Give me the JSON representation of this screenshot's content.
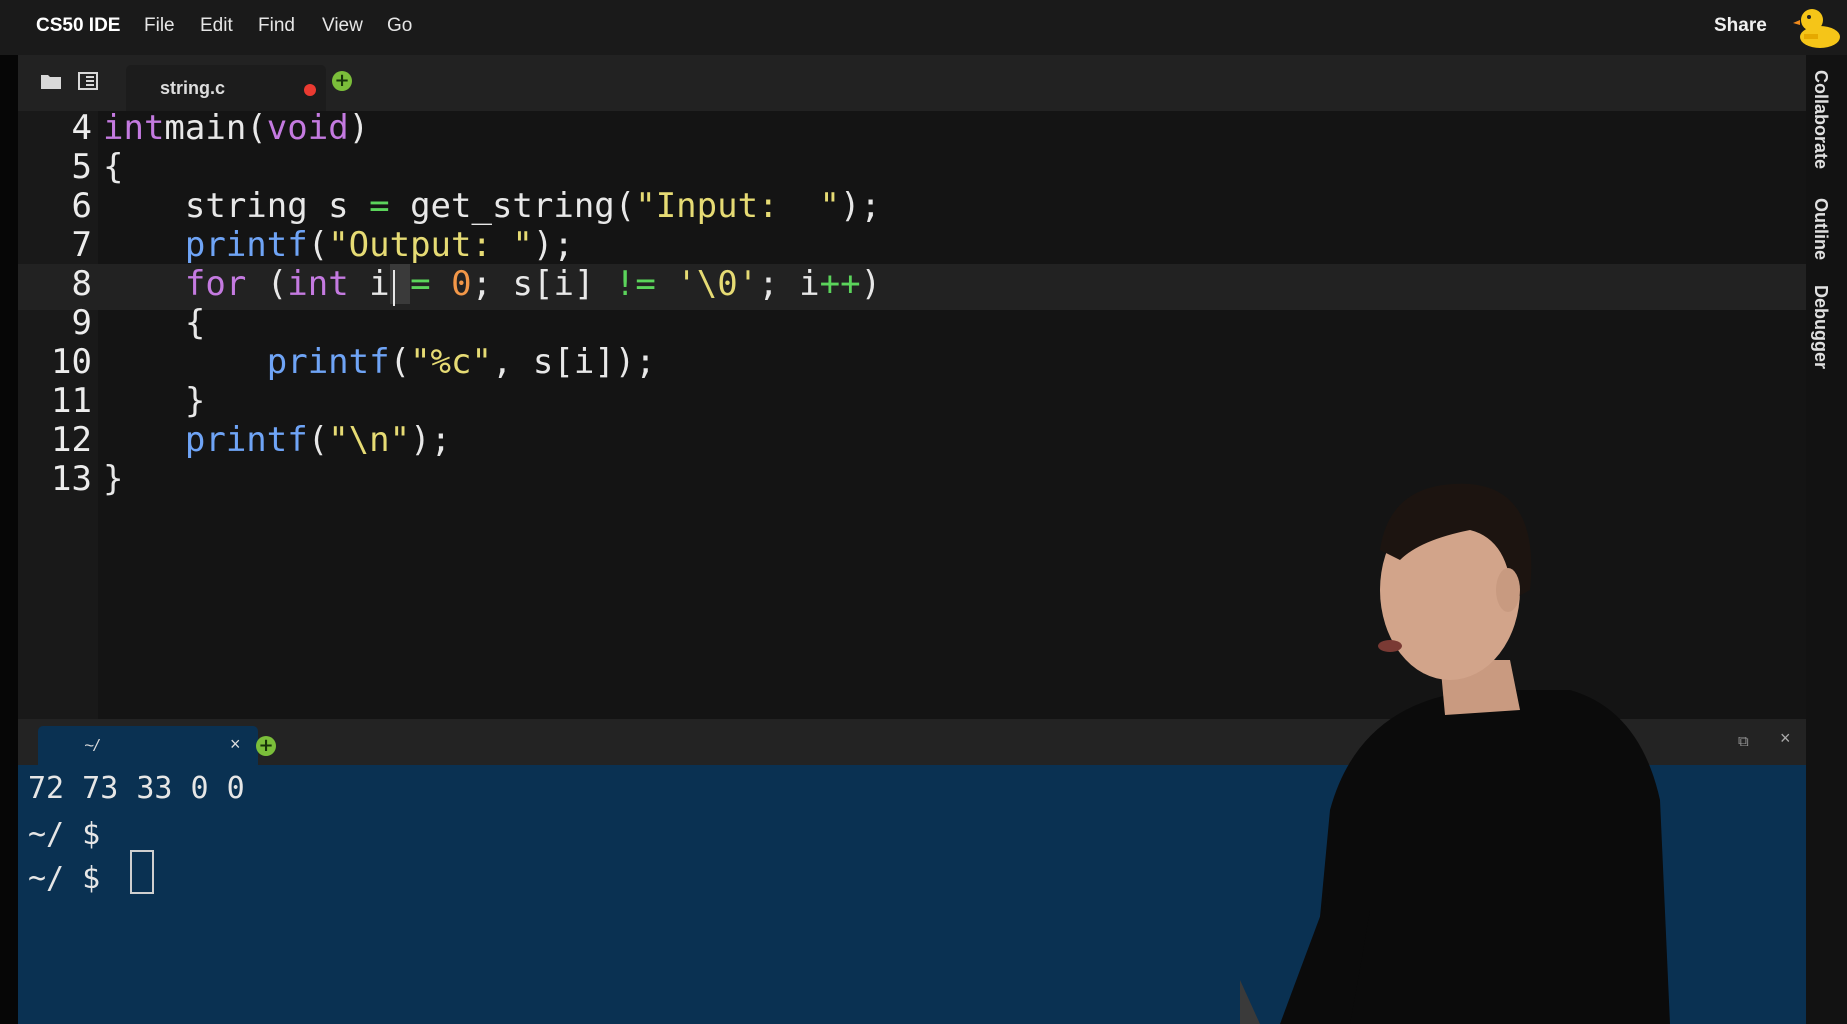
{
  "menubar": {
    "brand": "CS50 IDE",
    "items": [
      "File",
      "Edit",
      "Find",
      "View",
      "Go"
    ],
    "share_label": "Share"
  },
  "right_panel": {
    "tabs": [
      "Collaborate",
      "Outline",
      "Debugger"
    ]
  },
  "editor_tab": {
    "filename": "string.c",
    "unsaved": true
  },
  "editor": {
    "first_visible_line": 4,
    "active_line": 8,
    "lines": [
      {
        "n": "4",
        "tokens": [
          [
            "kw",
            "int"
          ],
          [
            "",
            "main("
          ],
          [
            "kw",
            "void"
          ],
          [
            "",
            ")"
          ]
        ]
      },
      {
        "n": "5",
        "tokens": [
          [
            "",
            "{"
          ]
        ]
      },
      {
        "n": "6",
        "tokens": [
          [
            "",
            "    string s "
          ],
          [
            "op",
            "="
          ],
          [
            "",
            " get_string("
          ],
          [
            "str",
            "\"Input:  \""
          ],
          [
            "",
            ");"
          ]
        ]
      },
      {
        "n": "7",
        "tokens": [
          [
            "",
            "    "
          ],
          [
            "fn",
            "printf"
          ],
          [
            "",
            "("
          ],
          [
            "str",
            "\"Output: \""
          ],
          [
            "",
            ");"
          ]
        ]
      },
      {
        "n": "8",
        "tokens": [
          [
            "",
            "    "
          ],
          [
            "kw",
            "for"
          ],
          [
            "",
            " ("
          ],
          [
            "kw",
            "int"
          ],
          [
            "",
            " i"
          ],
          [
            "sel",
            " "
          ],
          [
            "op",
            "="
          ],
          [
            "",
            " "
          ],
          [
            "num",
            "0"
          ],
          [
            "",
            ";"
          ],
          [
            "",
            " s[i] "
          ],
          [
            "op",
            "!="
          ],
          [
            "",
            " "
          ],
          [
            "str",
            "'\\0'"
          ],
          [
            "",
            "; i"
          ],
          [
            "op",
            "++"
          ],
          [
            "",
            ")"
          ]
        ]
      },
      {
        "n": "9",
        "tokens": [
          [
            "",
            "    {"
          ]
        ]
      },
      {
        "n": "10",
        "tokens": [
          [
            "",
            "        "
          ],
          [
            "fn",
            "printf"
          ],
          [
            "",
            "("
          ],
          [
            "str",
            "\"%c\""
          ],
          [
            "",
            ", s[i]);"
          ]
        ]
      },
      {
        "n": "11",
        "tokens": [
          [
            "",
            "    }"
          ]
        ]
      },
      {
        "n": "12",
        "tokens": [
          [
            "",
            "    "
          ],
          [
            "fn",
            "printf"
          ],
          [
            "",
            "("
          ],
          [
            "str",
            "\"\\n\""
          ],
          [
            "",
            ");"
          ]
        ]
      },
      {
        "n": "13",
        "tokens": [
          [
            "",
            "}"
          ]
        ]
      }
    ]
  },
  "terminal_tab": {
    "label": "~/",
    "close": "×"
  },
  "terminal": {
    "lines": [
      "72 73 33 0 0",
      "~/ $",
      "~/ $"
    ]
  },
  "colors": {
    "keyword": "#c47ae0",
    "function": "#6fa4f6",
    "string": "#e6db74",
    "number": "#f29748",
    "operator": "#5bd45b",
    "terminal_bg": "#0a3152"
  }
}
